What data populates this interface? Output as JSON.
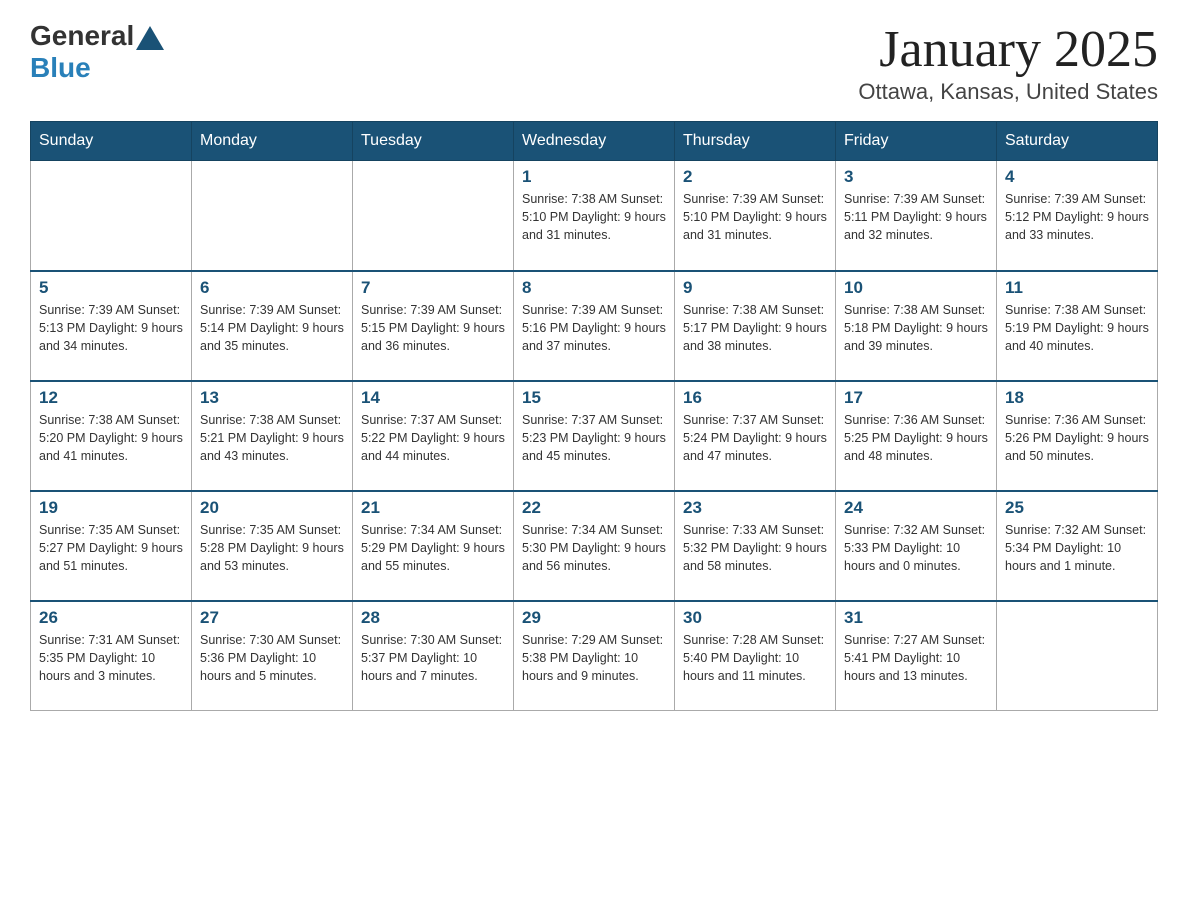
{
  "logo": {
    "text_general": "General",
    "text_blue": "Blue"
  },
  "title": "January 2025",
  "subtitle": "Ottawa, Kansas, United States",
  "header_days": [
    "Sunday",
    "Monday",
    "Tuesday",
    "Wednesday",
    "Thursday",
    "Friday",
    "Saturday"
  ],
  "weeks": [
    [
      {
        "day": "",
        "info": ""
      },
      {
        "day": "",
        "info": ""
      },
      {
        "day": "",
        "info": ""
      },
      {
        "day": "1",
        "info": "Sunrise: 7:38 AM\nSunset: 5:10 PM\nDaylight: 9 hours\nand 31 minutes."
      },
      {
        "day": "2",
        "info": "Sunrise: 7:39 AM\nSunset: 5:10 PM\nDaylight: 9 hours\nand 31 minutes."
      },
      {
        "day": "3",
        "info": "Sunrise: 7:39 AM\nSunset: 5:11 PM\nDaylight: 9 hours\nand 32 minutes."
      },
      {
        "day": "4",
        "info": "Sunrise: 7:39 AM\nSunset: 5:12 PM\nDaylight: 9 hours\nand 33 minutes."
      }
    ],
    [
      {
        "day": "5",
        "info": "Sunrise: 7:39 AM\nSunset: 5:13 PM\nDaylight: 9 hours\nand 34 minutes."
      },
      {
        "day": "6",
        "info": "Sunrise: 7:39 AM\nSunset: 5:14 PM\nDaylight: 9 hours\nand 35 minutes."
      },
      {
        "day": "7",
        "info": "Sunrise: 7:39 AM\nSunset: 5:15 PM\nDaylight: 9 hours\nand 36 minutes."
      },
      {
        "day": "8",
        "info": "Sunrise: 7:39 AM\nSunset: 5:16 PM\nDaylight: 9 hours\nand 37 minutes."
      },
      {
        "day": "9",
        "info": "Sunrise: 7:38 AM\nSunset: 5:17 PM\nDaylight: 9 hours\nand 38 minutes."
      },
      {
        "day": "10",
        "info": "Sunrise: 7:38 AM\nSunset: 5:18 PM\nDaylight: 9 hours\nand 39 minutes."
      },
      {
        "day": "11",
        "info": "Sunrise: 7:38 AM\nSunset: 5:19 PM\nDaylight: 9 hours\nand 40 minutes."
      }
    ],
    [
      {
        "day": "12",
        "info": "Sunrise: 7:38 AM\nSunset: 5:20 PM\nDaylight: 9 hours\nand 41 minutes."
      },
      {
        "day": "13",
        "info": "Sunrise: 7:38 AM\nSunset: 5:21 PM\nDaylight: 9 hours\nand 43 minutes."
      },
      {
        "day": "14",
        "info": "Sunrise: 7:37 AM\nSunset: 5:22 PM\nDaylight: 9 hours\nand 44 minutes."
      },
      {
        "day": "15",
        "info": "Sunrise: 7:37 AM\nSunset: 5:23 PM\nDaylight: 9 hours\nand 45 minutes."
      },
      {
        "day": "16",
        "info": "Sunrise: 7:37 AM\nSunset: 5:24 PM\nDaylight: 9 hours\nand 47 minutes."
      },
      {
        "day": "17",
        "info": "Sunrise: 7:36 AM\nSunset: 5:25 PM\nDaylight: 9 hours\nand 48 minutes."
      },
      {
        "day": "18",
        "info": "Sunrise: 7:36 AM\nSunset: 5:26 PM\nDaylight: 9 hours\nand 50 minutes."
      }
    ],
    [
      {
        "day": "19",
        "info": "Sunrise: 7:35 AM\nSunset: 5:27 PM\nDaylight: 9 hours\nand 51 minutes."
      },
      {
        "day": "20",
        "info": "Sunrise: 7:35 AM\nSunset: 5:28 PM\nDaylight: 9 hours\nand 53 minutes."
      },
      {
        "day": "21",
        "info": "Sunrise: 7:34 AM\nSunset: 5:29 PM\nDaylight: 9 hours\nand 55 minutes."
      },
      {
        "day": "22",
        "info": "Sunrise: 7:34 AM\nSunset: 5:30 PM\nDaylight: 9 hours\nand 56 minutes."
      },
      {
        "day": "23",
        "info": "Sunrise: 7:33 AM\nSunset: 5:32 PM\nDaylight: 9 hours\nand 58 minutes."
      },
      {
        "day": "24",
        "info": "Sunrise: 7:32 AM\nSunset: 5:33 PM\nDaylight: 10 hours\nand 0 minutes."
      },
      {
        "day": "25",
        "info": "Sunrise: 7:32 AM\nSunset: 5:34 PM\nDaylight: 10 hours\nand 1 minute."
      }
    ],
    [
      {
        "day": "26",
        "info": "Sunrise: 7:31 AM\nSunset: 5:35 PM\nDaylight: 10 hours\nand 3 minutes."
      },
      {
        "day": "27",
        "info": "Sunrise: 7:30 AM\nSunset: 5:36 PM\nDaylight: 10 hours\nand 5 minutes."
      },
      {
        "day": "28",
        "info": "Sunrise: 7:30 AM\nSunset: 5:37 PM\nDaylight: 10 hours\nand 7 minutes."
      },
      {
        "day": "29",
        "info": "Sunrise: 7:29 AM\nSunset: 5:38 PM\nDaylight: 10 hours\nand 9 minutes."
      },
      {
        "day": "30",
        "info": "Sunrise: 7:28 AM\nSunset: 5:40 PM\nDaylight: 10 hours\nand 11 minutes."
      },
      {
        "day": "31",
        "info": "Sunrise: 7:27 AM\nSunset: 5:41 PM\nDaylight: 10 hours\nand 13 minutes."
      },
      {
        "day": "",
        "info": ""
      }
    ]
  ],
  "colors": {
    "header_bg": "#1a5276",
    "header_text": "#ffffff",
    "day_number": "#1a5276",
    "border": "#aaa",
    "row_border": "#1a5276"
  }
}
